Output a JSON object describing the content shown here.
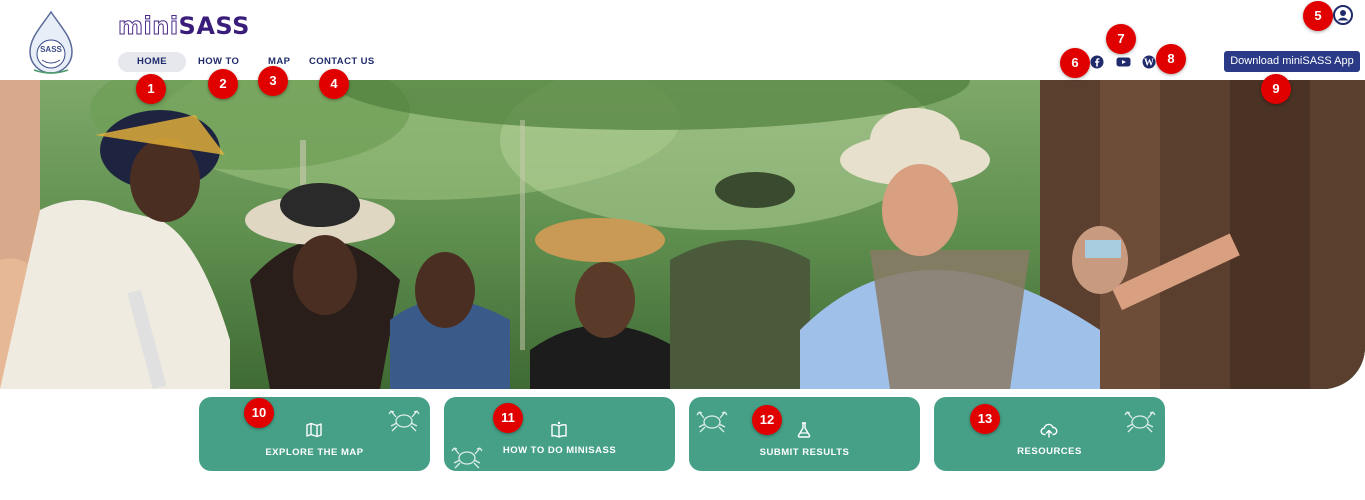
{
  "brand": {
    "name_prefix": "mini",
    "name_suffix": "SASS",
    "logo_text": "SASS"
  },
  "nav": {
    "home": "HOME",
    "how_to": "HOW TO",
    "map": "MAP",
    "contact": "CONTACT US",
    "active": "HOME"
  },
  "header_right": {
    "download_button": "Download miniSASS App",
    "social_icons": [
      "facebook-icon",
      "youtube-icon",
      "wordpress-icon"
    ],
    "account_icon": "user-account-icon"
  },
  "hero": {
    "description": "Group of people in sun hats listening outdoors in a forest; a man in waders points to the right"
  },
  "cards": [
    {
      "label": "EXPLORE THE MAP",
      "icon": "map-icon"
    },
    {
      "label": "HOW TO DO MINISASS",
      "icon": "open-book-icon"
    },
    {
      "label": "SUBMIT RESULTS",
      "icon": "flask-icon"
    },
    {
      "label": "RESOURCES",
      "icon": "cloud-upload-icon"
    }
  ],
  "annotations": [
    "1",
    "2",
    "3",
    "4",
    "5",
    "6",
    "7",
    "8",
    "9",
    "10",
    "11",
    "12",
    "13"
  ],
  "colors": {
    "nav_text": "#1f2b6b",
    "button_bg": "#2a3a86",
    "card_bg": "#46a087",
    "badge": "#e00000",
    "brand": "#3a1d7a"
  }
}
